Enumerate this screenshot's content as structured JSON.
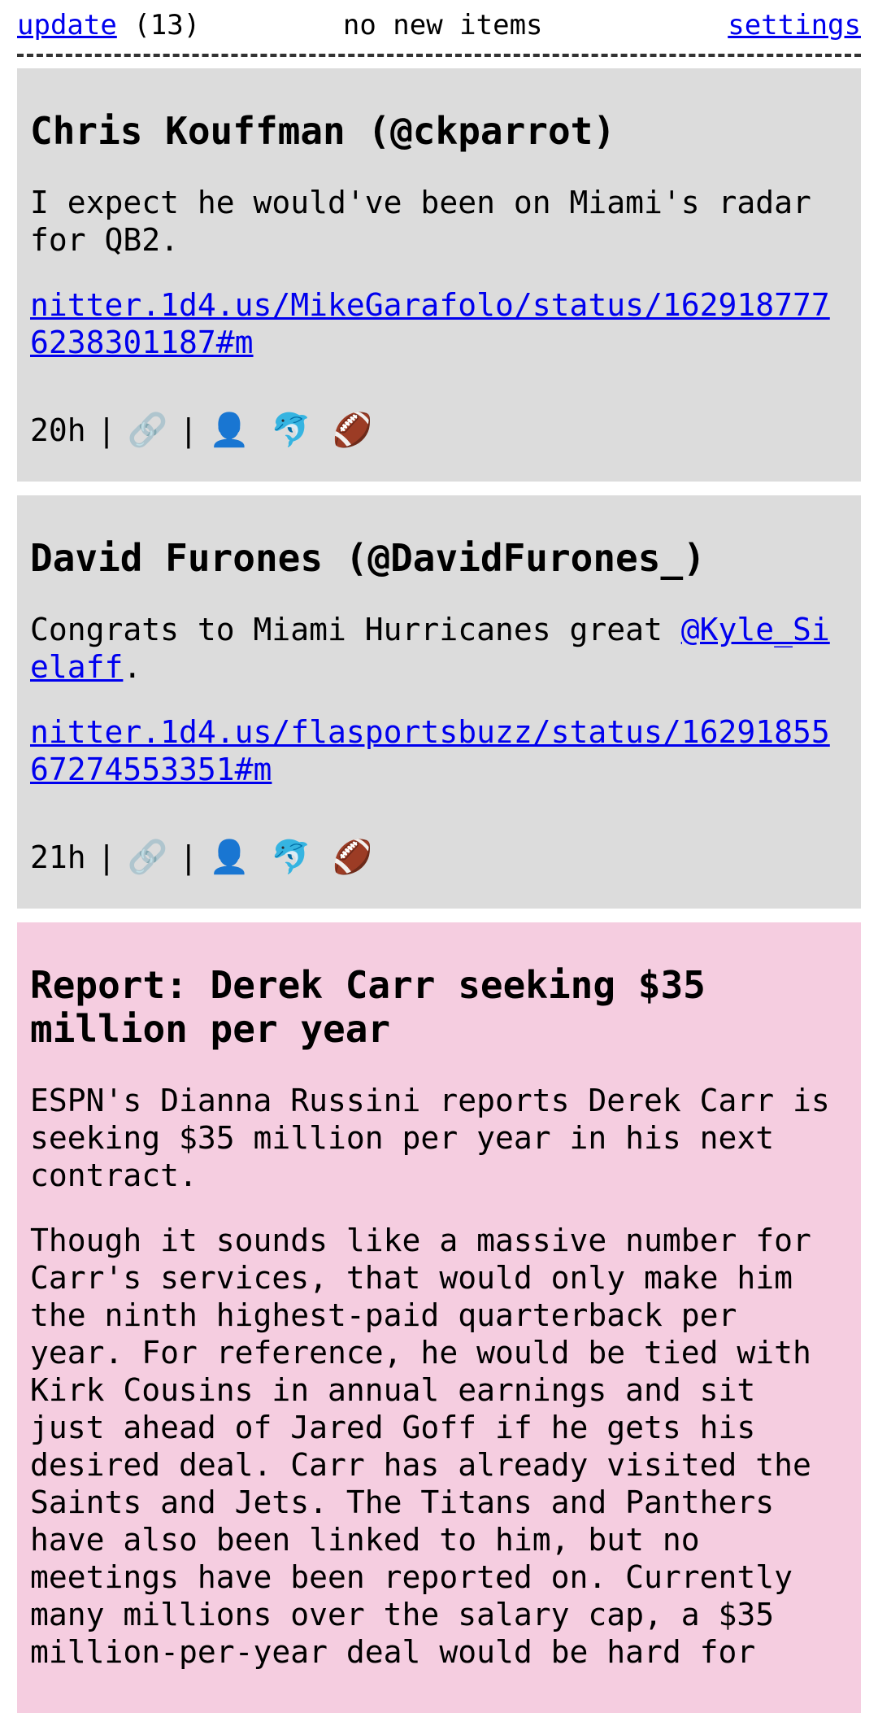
{
  "topbar": {
    "update_label": "update",
    "update_count": "(13)",
    "status": "no new items",
    "settings_label": "settings"
  },
  "posts": [
    {
      "title": "Chris Kouffman (@ckparrot)",
      "text": "I expect he would've been on Miami's radar for QB2.",
      "link": "nitter.1d4.us/MikeGarafolo/status/1629187776238301187#m",
      "time": "20h",
      "separator": "|",
      "icons": {
        "link": "🔗",
        "user": "👤",
        "dolphin": "🐬",
        "football": "🏈"
      }
    },
    {
      "title": "David Furones (@DavidFurones_)",
      "text_before": "Congrats to Miami Hurricanes great ",
      "mention": "@Kyle_Sielaff",
      "text_after": ".",
      "link": "nitter.1d4.us/flasportsbuzz/status/1629185567274553351#m",
      "time": "21h",
      "separator": "|",
      "icons": {
        "link": "🔗",
        "user": "👤",
        "dolphin": "🐬",
        "football": "🏈"
      }
    }
  ],
  "article": {
    "title": "Report: Derek Carr seeking $35 million per year",
    "paragraphs": [
      "ESPN's Dianna Russini reports Derek Carr is seeking $35 million per year in his next contract.",
      "Though it sounds like a massive number for Carr's services, that would only make him the ninth highest-paid quarterback per year. For reference, he would be tied with Kirk Cousins in annual earnings and sit just ahead of Jared Goff if he gets his desired deal. Carr has already visited the Saints and Jets. The Titans and Panthers have also been linked to him, but no meetings have been reported on. Currently many millions over the salary cap, a $35 million-per-year deal would be hard for"
    ]
  },
  "colors": {
    "card_bg": "#dcdcdc",
    "highlight_bg": "#f5cde0",
    "link": "#0000ee"
  }
}
